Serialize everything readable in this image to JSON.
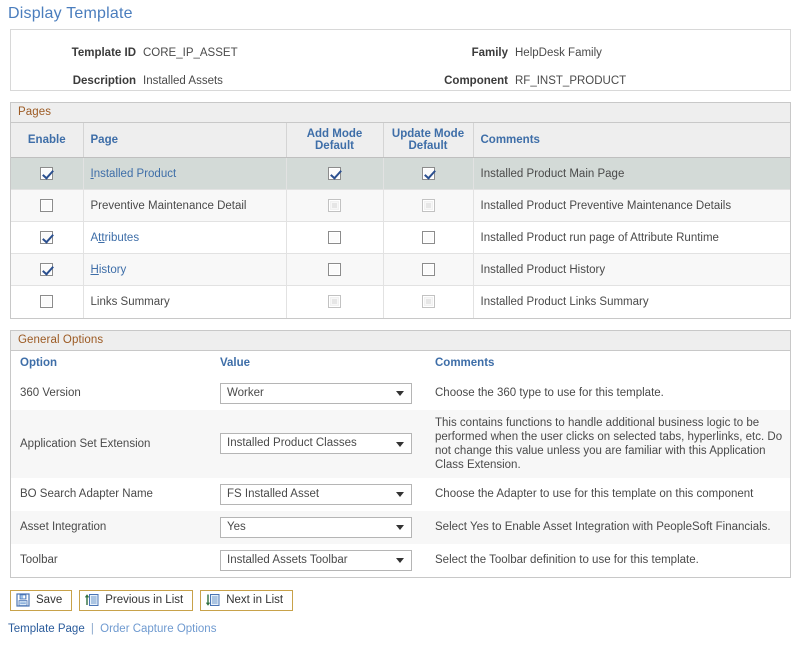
{
  "page": {
    "title": "Display Template"
  },
  "header": {
    "fields": [
      {
        "label": "Template ID",
        "value": "CORE_IP_ASSET"
      },
      {
        "label": "Family",
        "value": "HelpDesk Family"
      },
      {
        "label": "Description",
        "value": "Installed Assets"
      },
      {
        "label": "Component",
        "value": "RF_INST_PRODUCT"
      }
    ]
  },
  "pages_section": {
    "title": "Pages",
    "columns": {
      "enable": "Enable",
      "page": "Page",
      "add_mode": "Add Mode Default",
      "add_mode_l1": "Add Mode",
      "add_mode_l2": "Default",
      "update_mode": "Update Mode Default",
      "update_mode_l1": "Update Mode",
      "update_mode_l2": "Default",
      "comments": "Comments"
    },
    "rows": [
      {
        "page": "Installed Product",
        "page_accesskey": "I",
        "page_is_link": true,
        "enable_checked": true,
        "enable_enabled": true,
        "add_mode_checked": true,
        "add_mode_enabled": true,
        "update_mode_checked": true,
        "update_mode_enabled": true,
        "comments": "Installed Product Main Page",
        "selected": true
      },
      {
        "page": "Preventive Maintenance Detail",
        "page_accesskey": "",
        "page_is_link": false,
        "enable_checked": false,
        "enable_enabled": true,
        "add_mode_checked": false,
        "add_mode_enabled": false,
        "update_mode_checked": false,
        "update_mode_enabled": false,
        "comments": "Installed Product Preventive Maintenance Details",
        "selected": false
      },
      {
        "page": "Attributes",
        "page_accesskey": "tt",
        "page_is_link": true,
        "enable_checked": true,
        "enable_enabled": true,
        "add_mode_checked": false,
        "add_mode_enabled": true,
        "update_mode_checked": false,
        "update_mode_enabled": true,
        "comments": "Installed Product run page of Attribute Runtime",
        "selected": false
      },
      {
        "page": "History",
        "page_accesskey": "H",
        "page_is_link": true,
        "enable_checked": true,
        "enable_enabled": true,
        "add_mode_checked": false,
        "add_mode_enabled": true,
        "update_mode_checked": false,
        "update_mode_enabled": true,
        "comments": "Installed Product History",
        "selected": false
      },
      {
        "page": "Links Summary",
        "page_accesskey": "",
        "page_is_link": false,
        "enable_checked": false,
        "enable_enabled": true,
        "add_mode_checked": false,
        "add_mode_enabled": false,
        "update_mode_checked": false,
        "update_mode_enabled": false,
        "comments": "Installed Product Links Summary",
        "selected": false
      }
    ]
  },
  "general_options": {
    "title": "General Options",
    "columns": {
      "option": "Option",
      "value": "Value",
      "comments": "Comments"
    },
    "rows": [
      {
        "option": "360 Version",
        "value": "Worker",
        "comments": "Choose the 360 type to use for this template."
      },
      {
        "option": "Application Set Extension",
        "value": "Installed Product Classes",
        "comments": "This contains functions to handle additional business logic to be performed when the user clicks on selected tabs, hyperlinks, etc. Do not change this value unless you are familiar with this Application Class Extension."
      },
      {
        "option": "BO Search Adapter Name",
        "value": "FS Installed Asset",
        "comments": "Choose the Adapter to use for this template on this component"
      },
      {
        "option": "Asset Integration",
        "value": "Yes",
        "comments": "Select Yes to Enable Asset Integration with PeopleSoft Financials."
      },
      {
        "option": "Toolbar",
        "value": "Installed Assets Toolbar",
        "comments": "Select the Toolbar definition to use for this template."
      }
    ]
  },
  "toolbar": {
    "buttons": [
      {
        "label": "Save",
        "icon": "save-floppy-icon"
      },
      {
        "label": "Previous in List",
        "icon": "previous-in-list-icon"
      },
      {
        "label": "Next in List",
        "icon": "next-in-list-icon"
      }
    ]
  },
  "footer": {
    "links": [
      {
        "label": "Template Page",
        "style": "strong"
      },
      {
        "label": "Order Capture Options",
        "style": "soft"
      }
    ],
    "separator": "|"
  },
  "colors": {
    "title_blue": "#4a7dbd",
    "section_header_text": "#9c5a23",
    "column_header_text": "#3e6ea8",
    "link_blue": "#3e6ea8",
    "selected_row": "#d3dad7",
    "button_border": "#c8a24a"
  }
}
